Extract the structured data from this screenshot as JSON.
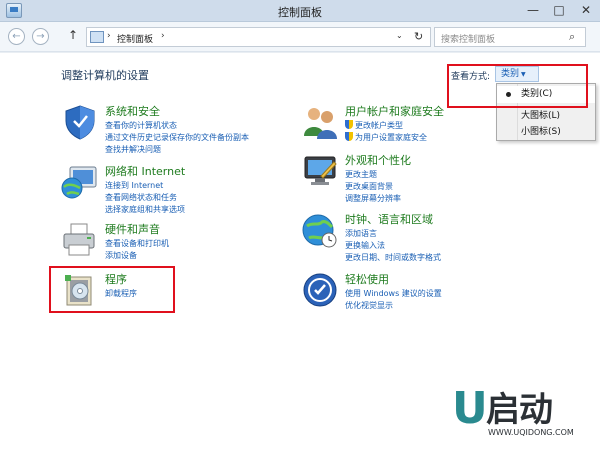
{
  "window": {
    "title": "控制面板",
    "min_label": "—",
    "max_label": "□",
    "close_label": "✕"
  },
  "nav": {
    "back_icon": "←",
    "forward_icon": "→",
    "up_icon": "↑",
    "breadcrumb_sep": "›",
    "address": "控制面板",
    "address_sep": "›",
    "dropdown_icon": "⌄",
    "refresh_icon": "↻",
    "search_placeholder": "搜索控制面板",
    "search_icon": "⌕"
  },
  "content": {
    "heading": "调整计算机的设置",
    "view_by_label": "查看方式:",
    "view_by_value": "类别",
    "view_by_arrow": "▼"
  },
  "view_menu": {
    "items": [
      {
        "label": "类别(C)",
        "selected": true
      },
      {
        "label": "大图标(L)",
        "selected": false
      },
      {
        "label": "小图标(S)",
        "selected": false
      }
    ]
  },
  "categories": [
    {
      "title": "系统和安全",
      "icon": "security-shield-icon",
      "links": [
        "查看你的计算机状态",
        "通过文件历史记录保存你的文件备份副本",
        "查找并解决问题"
      ]
    },
    {
      "title": "网络和 Internet",
      "icon": "network-globe-icon",
      "links": [
        "连接到 Internet",
        "查看网络状态和任务",
        "选择家庭组和共享选项"
      ]
    },
    {
      "title": "硬件和声音",
      "icon": "printer-icon",
      "links": [
        "查看设备和打印机",
        "添加设备"
      ]
    },
    {
      "title": "程序",
      "icon": "programs-icon",
      "links": [
        "卸载程序"
      ]
    },
    {
      "title": "用户帐户和家庭安全",
      "icon": "users-icon",
      "links": [
        "更改帐户类型",
        "为用户设置家庭安全"
      ]
    },
    {
      "title": "外观和个性化",
      "icon": "appearance-monitor-icon",
      "links": [
        "更改主题",
        "更改桌面背景",
        "调整屏幕分辨率"
      ]
    },
    {
      "title": "时钟、语言和区域",
      "icon": "clock-globe-icon",
      "links": [
        "添加语言",
        "更换输入法",
        "更改日期、时间或数字格式"
      ]
    },
    {
      "title": "轻松使用",
      "icon": "ease-of-access-icon",
      "links": [
        "使用 Windows 建议的设置",
        "优化视觉显示"
      ]
    }
  ],
  "watermark": {
    "letter": "U",
    "brand": "启动",
    "site": "WWW.UQIDONG.COM"
  },
  "colors": {
    "category_title": "#1e7b1e",
    "link": "#1a5fb4",
    "highlight_box": "#e0101d",
    "logo_teal": "#2a8a8f"
  }
}
